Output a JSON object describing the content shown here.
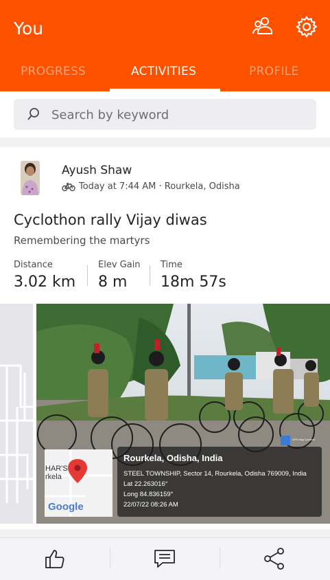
{
  "header": {
    "title": "You",
    "tabs": [
      {
        "label": "PROGRESS",
        "active": false
      },
      {
        "label": "ACTIVITIES",
        "active": true
      },
      {
        "label": "PROFILE",
        "active": false
      }
    ],
    "icons": [
      "people-icon",
      "gear-icon"
    ],
    "accent_color": "#fc5200"
  },
  "search": {
    "placeholder": "Search by keyword"
  },
  "activity": {
    "athlete": "Ayush Shaw",
    "meta": "Today at 7:44 AM · Rourkela, Odisha",
    "sport_icon": "bicycle-icon",
    "title": "Cyclothon rally Vijay diwas",
    "description": "Remembering the martyrs",
    "stats": [
      {
        "label": "Distance",
        "value": "3.02 km"
      },
      {
        "label": "Elev Gain",
        "value": "8 m"
      },
      {
        "label": "Time",
        "value": "18m 57s"
      }
    ],
    "photo_overlay": {
      "map_text": "HAR'S rkela",
      "map_brand": "Google",
      "app_badge": "GPS Map Camera",
      "place": "Rourkela, Odisha, India",
      "address": "STEEL TOWNSHIP, Sector 14, Rourkela, Odisha 769009, India",
      "lat": "Lat 22.263016°",
      "long": "Long 84.836159°",
      "datetime": "22/07/22 08:26 AM"
    }
  },
  "actions": [
    "like-icon",
    "comment-icon",
    "share-icon"
  ]
}
